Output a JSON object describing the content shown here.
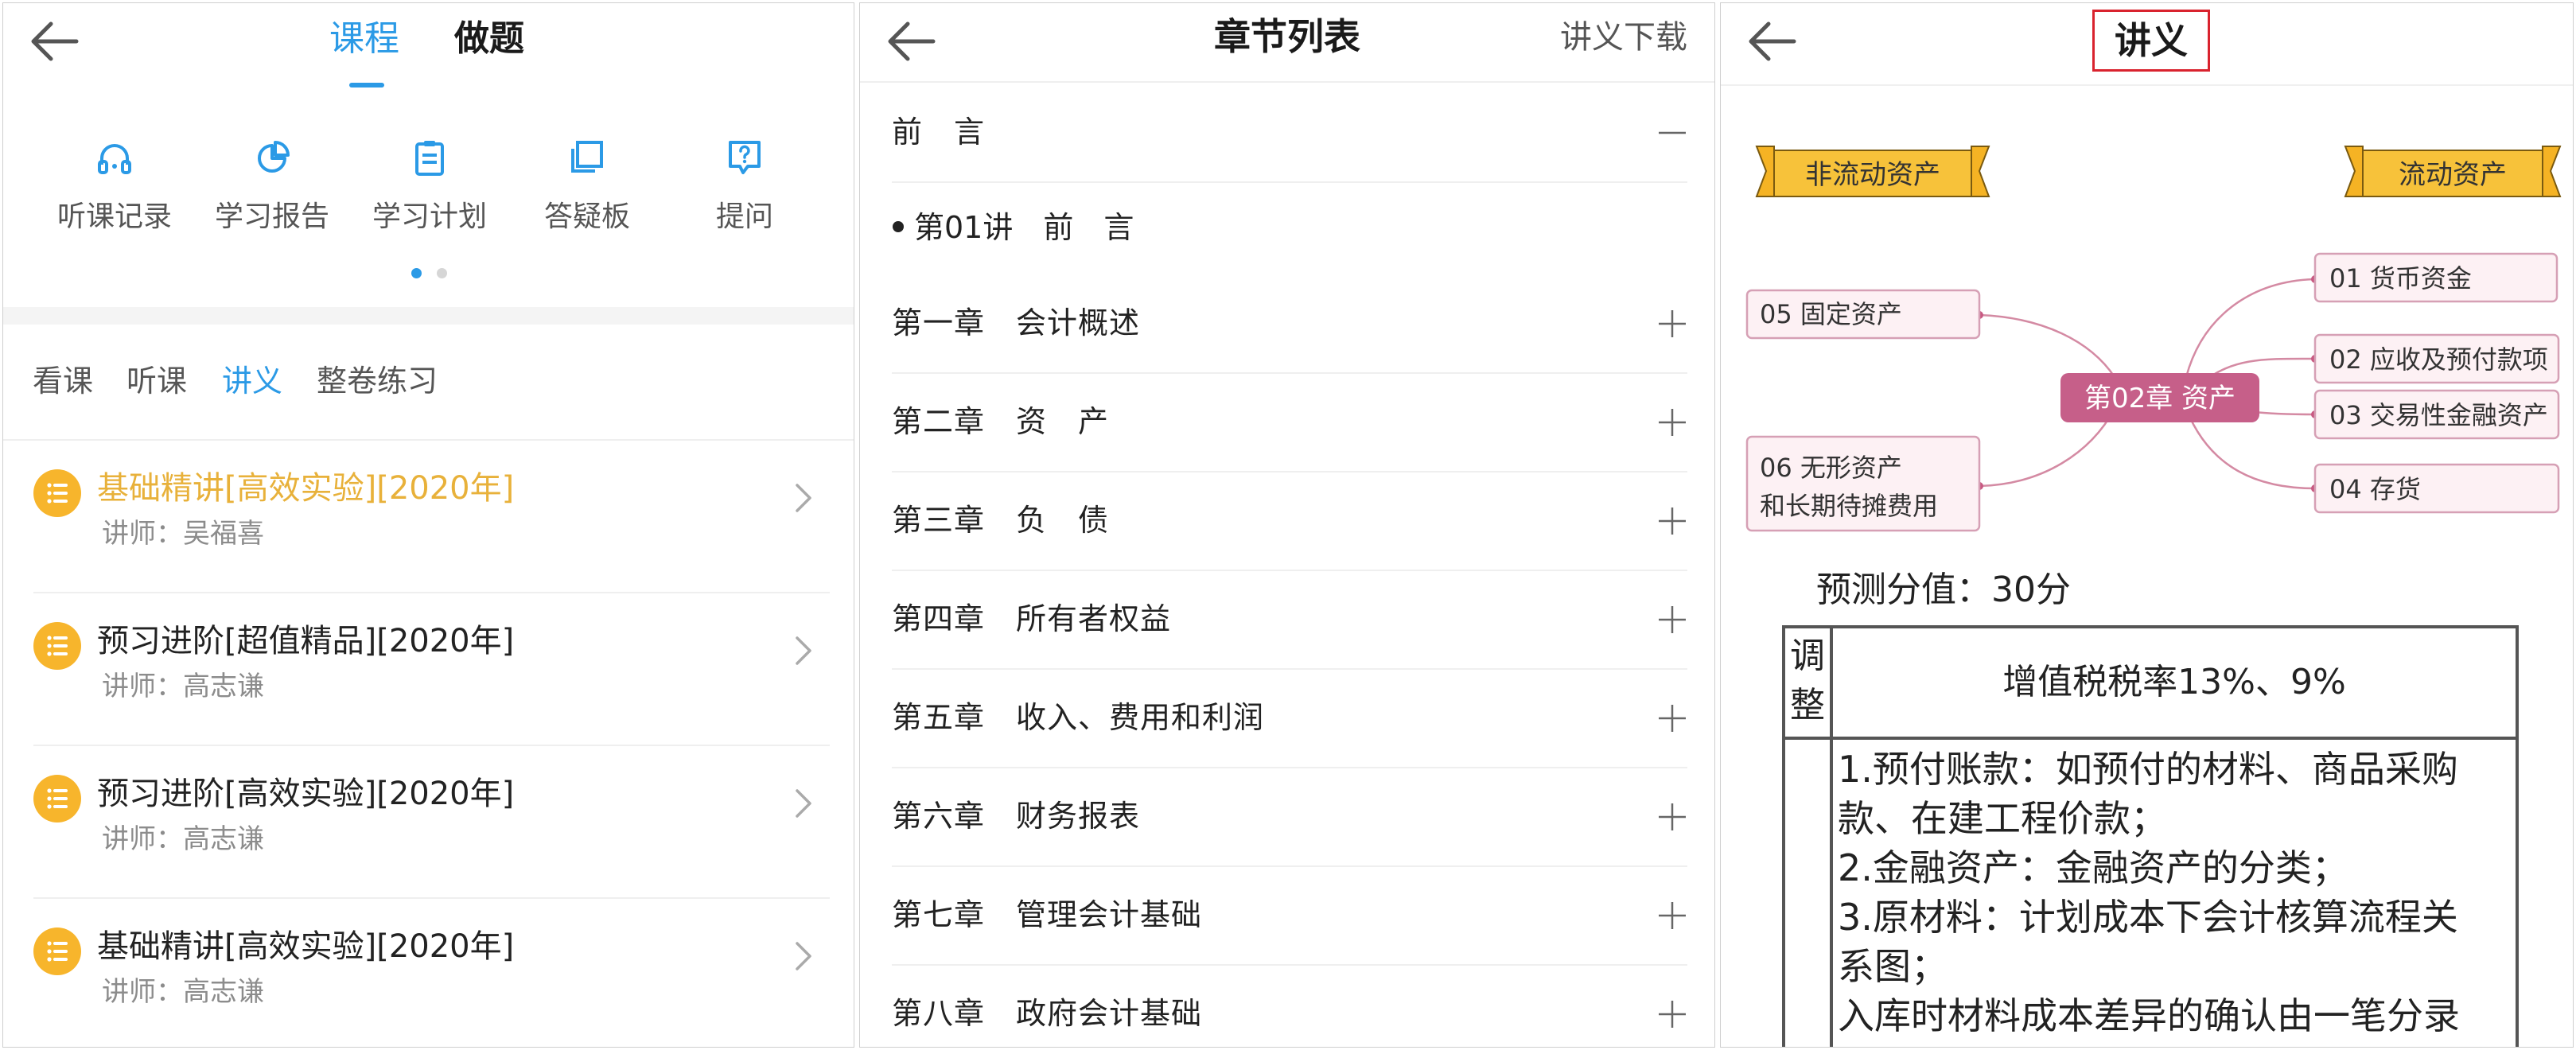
{
  "panel1": {
    "tabs": [
      {
        "label": "课程",
        "active": true
      },
      {
        "label": "做题",
        "active": false
      }
    ],
    "shortcuts": [
      {
        "label": "听课记录",
        "icon": "headphones-icon"
      },
      {
        "label": "学习报告",
        "icon": "pie-chart-icon"
      },
      {
        "label": "学习计划",
        "icon": "clipboard-icon"
      },
      {
        "label": "答疑板",
        "icon": "board-icon"
      },
      {
        "label": "提问",
        "icon": "question-bubble-icon"
      }
    ],
    "carousel": {
      "pages": 2,
      "current": 1
    },
    "subtabs": [
      {
        "label": "看课",
        "active": false
      },
      {
        "label": "听课",
        "active": false
      },
      {
        "label": "讲义",
        "active": true
      },
      {
        "label": "整卷练习",
        "active": false
      }
    ],
    "courses": [
      {
        "title": "基础精讲[高效实验][2020年]",
        "teacher": "讲师：吴福喜",
        "active": true
      },
      {
        "title": "预习进阶[超值精品][2020年]",
        "teacher": "讲师：高志谦",
        "active": false
      },
      {
        "title": "预习进阶[高效实验][2020年]",
        "teacher": "讲师：高志谦",
        "active": false
      },
      {
        "title": "基础精讲[高效实验][2020年]",
        "teacher": "讲师：高志谦",
        "active": false
      }
    ],
    "accent_color": "#2b9ae6",
    "highlight_color": "#e8b13a"
  },
  "panel2": {
    "title": "章节列表",
    "download_label": "讲义下载",
    "chapters": [
      {
        "label": "前　言",
        "expanded": true
      },
      {
        "label": "第一章　会计概述",
        "expanded": false
      },
      {
        "label": "第二章　资　产",
        "expanded": false
      },
      {
        "label": "第三章　负　债",
        "expanded": false
      },
      {
        "label": "第四章　所有者权益",
        "expanded": false
      },
      {
        "label": "第五章　收入、费用和利润",
        "expanded": false
      },
      {
        "label": "第六章　财务报表",
        "expanded": false
      },
      {
        "label": "第七章　管理会计基础",
        "expanded": false
      },
      {
        "label": "第八章　政府会计基础",
        "expanded": false
      }
    ],
    "lecture": "第01讲　前　言"
  },
  "panel3": {
    "title": "讲义",
    "mindmap": {
      "banner_left": "非流动资产",
      "banner_right": "流动资产",
      "center": "第02章  资产",
      "left_nodes": [
        "05  固定资产",
        "06  无形资产",
        "和长期待摊费用"
      ],
      "right_nodes": [
        "01  货币资金",
        "02  应收及预付款项",
        "03  交易性金融资产",
        "04  存货"
      ]
    },
    "predicted_score": "预测分值：30分",
    "table": {
      "adjust_label": [
        "调",
        "整"
      ],
      "rate": "增值税税率13%、9%",
      "body_lines": [
        "1.预付账款：如预付的材料、商品采购",
        "款、在建工程价款；",
        "2.金融资产：金融资产的分类；",
        "3.原材料：计划成本下会计核算流程关",
        "系图；",
        "入库时材料成本差异的确认由一笔分录"
      ]
    }
  }
}
